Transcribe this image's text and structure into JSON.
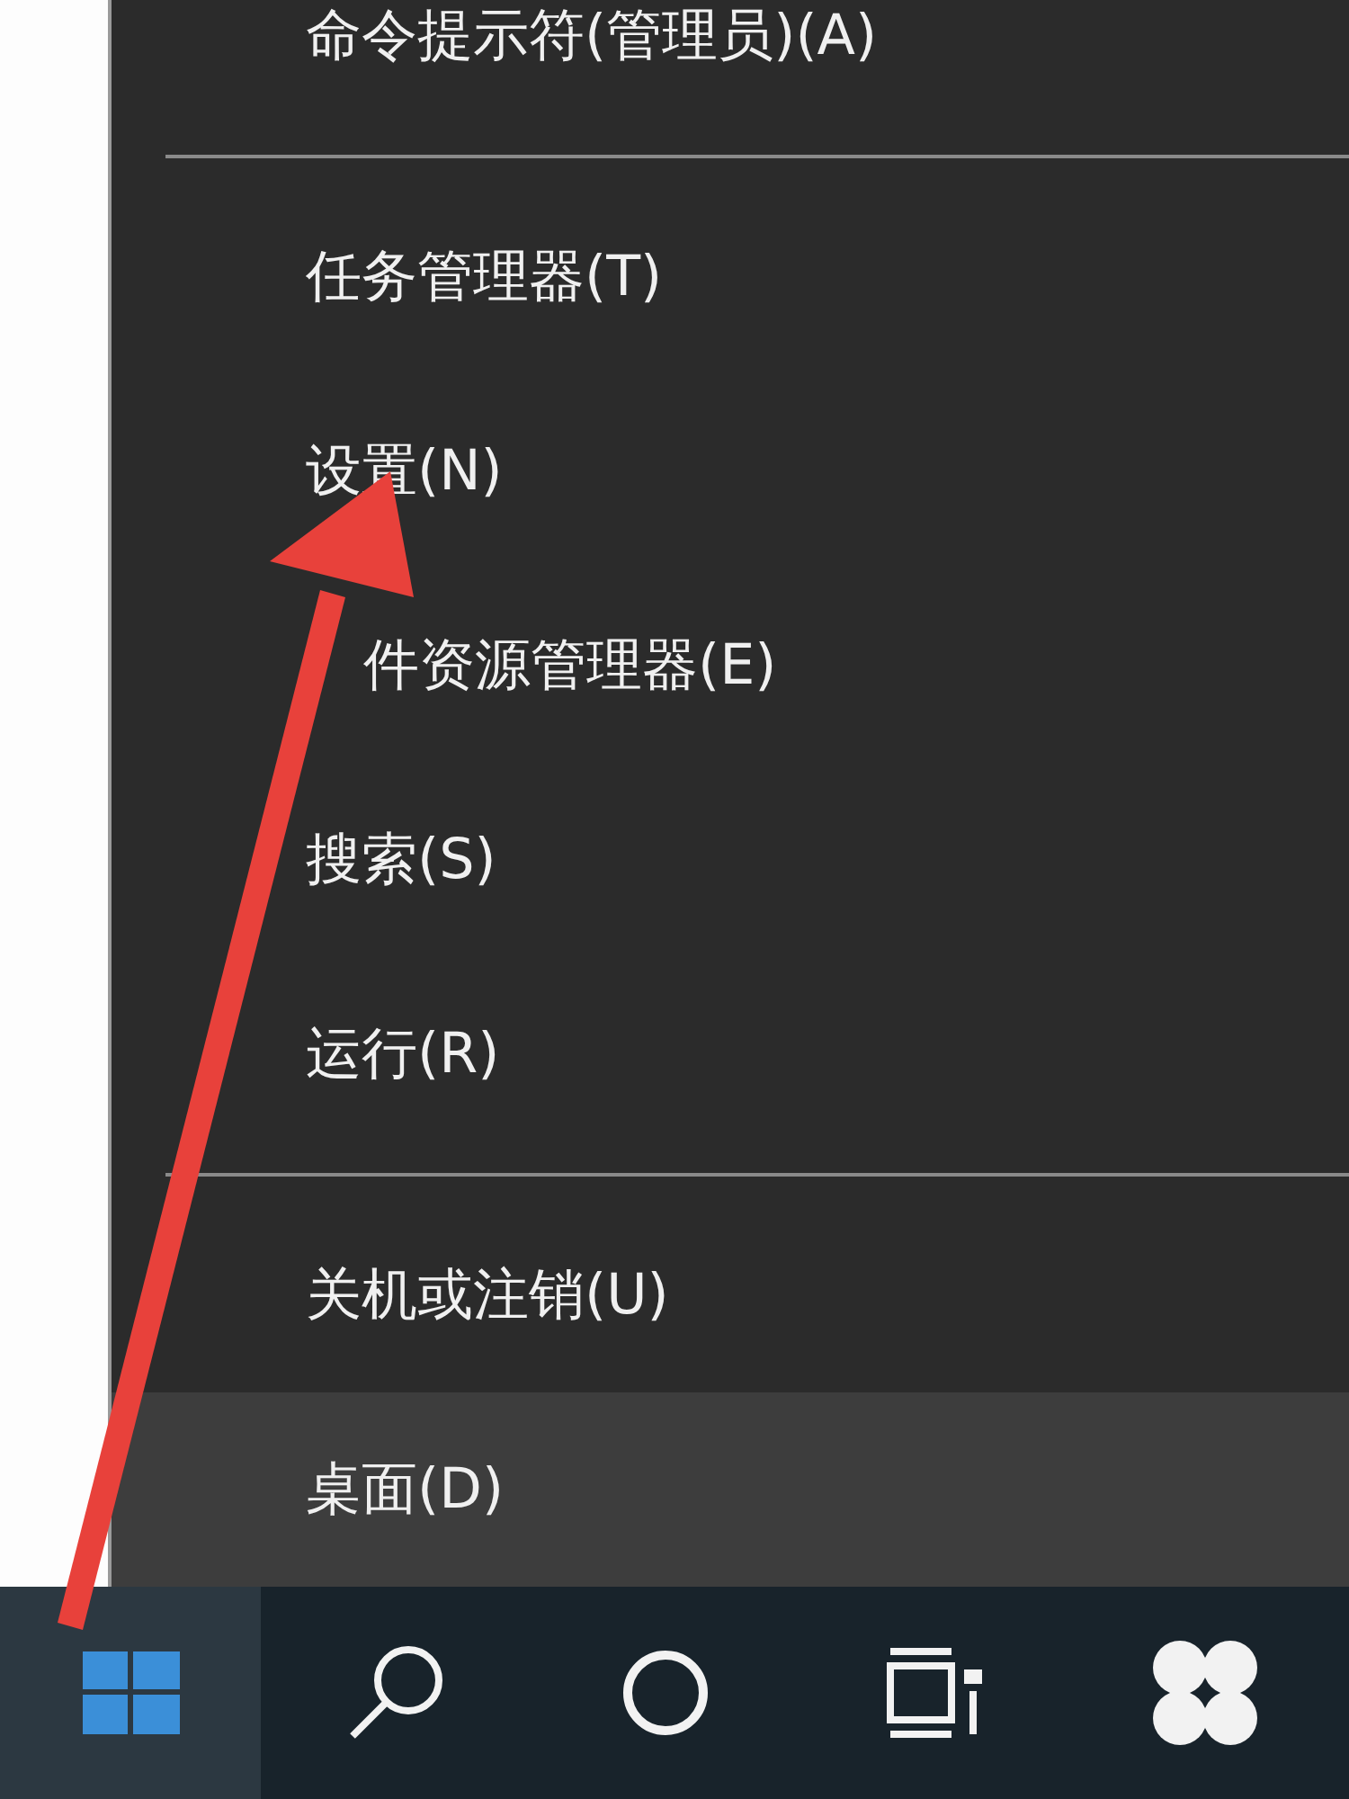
{
  "menu": {
    "groups": [
      [
        {
          "label": "命令提示符(管理员)(A)",
          "selected": false
        }
      ],
      [
        {
          "label": "任务管理器(T)",
          "selected": false
        },
        {
          "label": "设置(N)",
          "selected": false
        },
        {
          "label": "件资源管理器(E)",
          "selected": false
        },
        {
          "label": "搜索(S)",
          "selected": false
        },
        {
          "label": "运行(R)",
          "selected": false
        }
      ],
      [
        {
          "label": "关机或注销(U)",
          "selected": false
        },
        {
          "label": "桌面(D)",
          "selected": true
        }
      ]
    ]
  },
  "taskbar": {
    "buttons": [
      {
        "kind": "start",
        "selected": true
      },
      {
        "kind": "search",
        "selected": false
      },
      {
        "kind": "cortana",
        "selected": false
      },
      {
        "kind": "taskview",
        "selected": false
      },
      {
        "kind": "app",
        "selected": false
      }
    ]
  }
}
